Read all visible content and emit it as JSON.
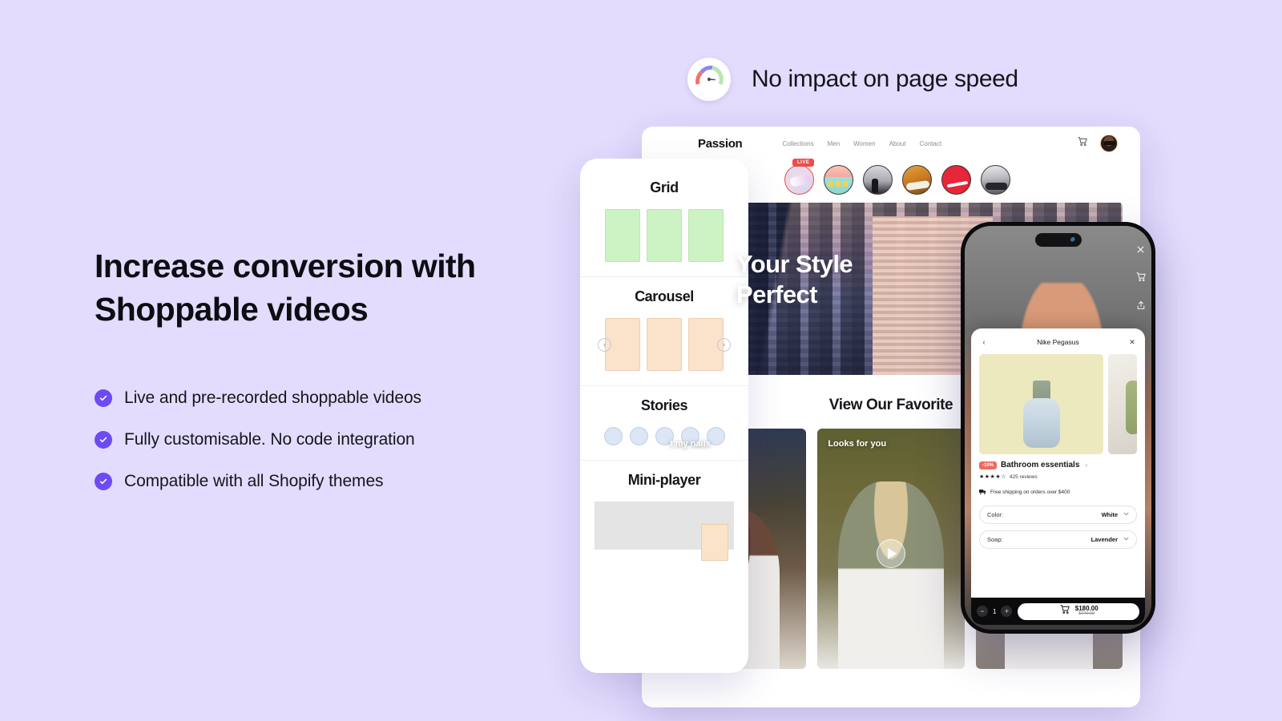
{
  "speed_badge": {
    "text": "No impact on page speed",
    "icon": "speedometer-gauge-icon"
  },
  "hero_copy": {
    "headline_line1": "Increase conversion with",
    "headline_line2": "Shoppable videos",
    "features": [
      "Live and pre-recorded shoppable videos",
      "Fully customisable.  No code integration",
      "Compatible with all Shopify  themes"
    ]
  },
  "layouts_panel": {
    "sections": [
      {
        "title": "Grid"
      },
      {
        "title": "Carousel"
      },
      {
        "title": "Stories"
      },
      {
        "title": "Mini-player"
      }
    ],
    "carousel_prev": "‹",
    "carousel_next": "›"
  },
  "site": {
    "logo": "Passion",
    "nav": [
      "Collections",
      "Men",
      "Women",
      "About",
      "Contact"
    ],
    "cart_icon": "shopping-cart-icon",
    "avatar": "user-avatar",
    "live_badge": "LIVE",
    "hero_line1": "Your Style",
    "hero_line2": "Perfect",
    "favorites_title": "View Our Favorite",
    "video_cards": [
      {
        "label": "t my nails"
      },
      {
        "label": "Looks for you"
      },
      {
        "label": ""
      }
    ]
  },
  "phone": {
    "side_icons": [
      "close-icon",
      "cart-icon",
      "share-icon"
    ],
    "sheet": {
      "back": "‹",
      "title": "Nike Pegasus",
      "close": "✕",
      "discount_badge": "-10%",
      "product_name": "Bathroom essentials",
      "chevron": "›",
      "stars": "★★★★☆",
      "reviews": "425 reviews",
      "shipping": "Free shipping on orders over $400",
      "variants": [
        {
          "label": "Color:",
          "value": "White"
        },
        {
          "label": "Soap:",
          "value": "Lavender"
        }
      ],
      "qty_minus": "−",
      "qty_value": "1",
      "qty_plus": "+",
      "price_current": "$180.00",
      "price_original": "$240.00"
    }
  },
  "colors": {
    "background": "#E3DCFD",
    "accent": "#6C4BF4",
    "live_red": "#EE4B4B",
    "discount_red": "#F2695E",
    "grid_tile": "#CDF2C4",
    "carousel_tile": "#FAE2CB",
    "story_dot": "#DCE6F5"
  }
}
